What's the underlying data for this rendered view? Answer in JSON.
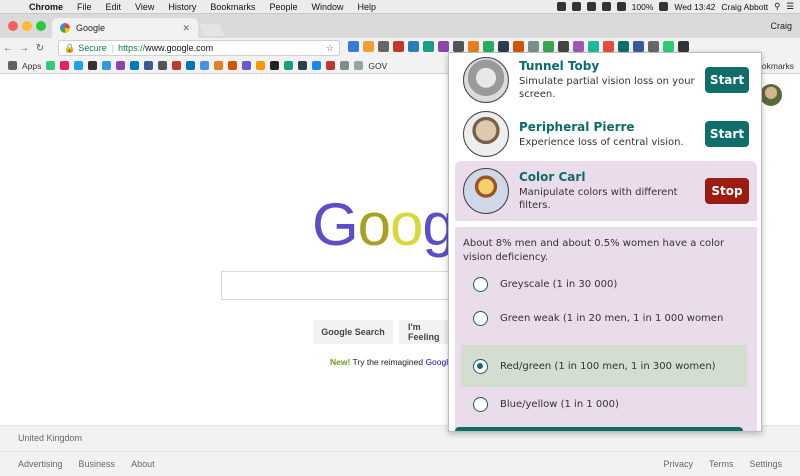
{
  "menubar": {
    "app": "Chrome",
    "items": [
      "File",
      "Edit",
      "View",
      "History",
      "Bookmarks",
      "People",
      "Window",
      "Help"
    ],
    "battery": "100%",
    "clock": "Wed 13:42",
    "user": "Craig Abbott"
  },
  "browser": {
    "tab_title": "Google",
    "profile": "Craig",
    "secure_label": "Secure",
    "url_proto": "https://",
    "url_host": "www.google.com",
    "bookmarks_apps": "Apps",
    "bookmarks_folder": "GOV",
    "bookmarks_right": "Bookmarks"
  },
  "google": {
    "search_button": "Google Search",
    "lucky_button": "I'm Feeling",
    "promo_new": "New!",
    "promo_text": " Try the reimagined ",
    "promo_link": "Google",
    "footer_country": "United Kingdom",
    "footer_links_left": [
      "Advertising",
      "Business",
      "About"
    ],
    "footer_links_right": [
      "Privacy",
      "Terms",
      "Settings"
    ]
  },
  "popup": {
    "simulators": [
      {
        "name": "Tunnel Toby",
        "desc": "Simulate partial vision loss on your screen.",
        "button": "Start"
      },
      {
        "name": "Peripheral Pierre",
        "desc": "Experience loss of central vision.",
        "button": "Start"
      },
      {
        "name": "Color Carl",
        "desc": "Manipulate colors with different filters.",
        "button": "Stop"
      }
    ],
    "info": "About 8% men and about 0.5% women have a color vision deficiency.",
    "options": [
      "Greyscale (1 in 30 000)",
      "Green weak (1 in 20 men, 1 in 1 000 women",
      "Red/green (1 in 100 men, 1 in 300 women)",
      "Blue/yellow (1 in 1 000)"
    ],
    "selected_option": "Red/green (1 in 100 men, 1 in 300 women)"
  },
  "colors": {
    "accent": "#0f6e6a",
    "stop": "#9b1c11",
    "panel": "#ebdcec"
  }
}
